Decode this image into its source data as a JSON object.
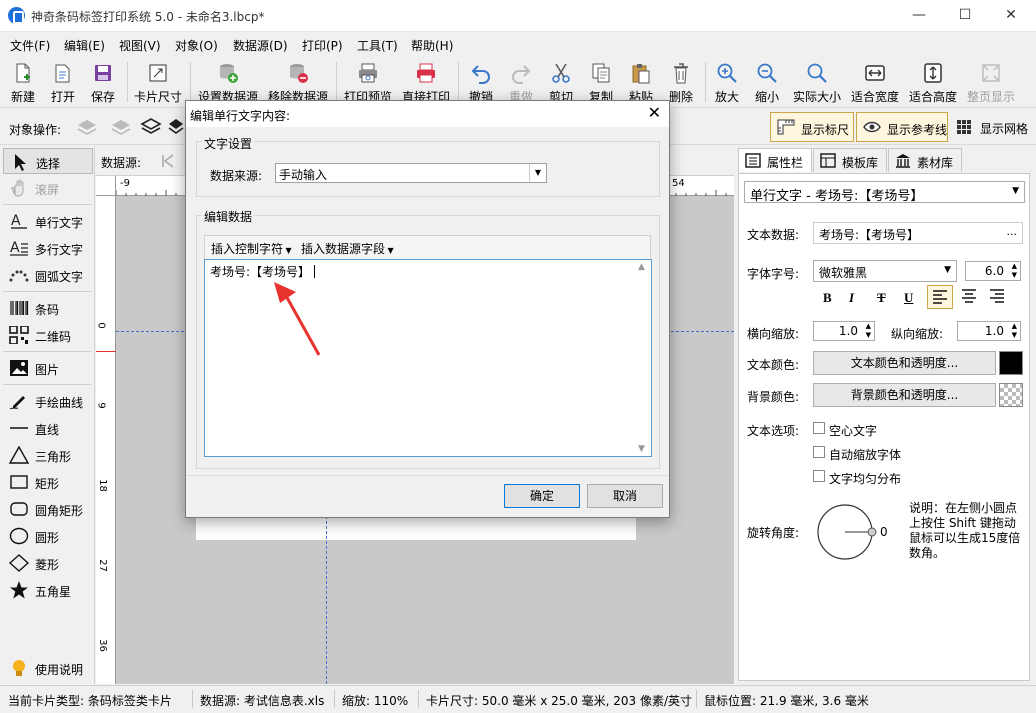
{
  "window": {
    "title": "神奇条码标签打印系统 5.0 - 未命名3.lbcp*"
  },
  "menu": [
    "文件(F)",
    "编辑(E)",
    "视图(V)",
    "对象(O)",
    "数据源(D)",
    "打印(P)",
    "工具(T)",
    "帮助(H)"
  ],
  "toolbar": {
    "new": "新建",
    "open": "打开",
    "save": "保存",
    "card_size": "卡片尺寸",
    "set_datasource": "设置数据源",
    "remove_datasource": "移除数据源",
    "print_preview": "打印预览",
    "direct_print": "直接打印",
    "undo": "撤销",
    "redo": "重做",
    "cut": "剪切",
    "copy": "复制",
    "paste": "粘贴",
    "delete": "删除",
    "zoom_in": "放大",
    "zoom_out": "缩小",
    "actual_size": "实际大小",
    "fit_width": "适合宽度",
    "fit_height": "适合高度",
    "fit_page": "整页显示"
  },
  "objbar": {
    "label": "对象操作:",
    "show_ruler": "显示标尺",
    "show_guides": "显示参考线",
    "show_grid": "显示网格"
  },
  "left_tools": {
    "select": "选择",
    "scroll": "滚屏",
    "single_text": "单行文字",
    "multi_text": "多行文字",
    "arc_text": "圆弧文字",
    "barcode": "条码",
    "qrcode": "二维码",
    "image": "图片",
    "freehand": "手绘曲线",
    "line": "直线",
    "triangle": "三角形",
    "rect": "矩形",
    "round_rect": "圆角矩形",
    "circle": "圆形",
    "diamond": "菱形",
    "star": "五角星",
    "help": "使用说明"
  },
  "canvas": {
    "datasource_label": "数据源:",
    "ruler_marks_h": [
      "-9",
      "54"
    ],
    "ruler_marks_v": [
      "0",
      "9",
      "18",
      "27",
      "36"
    ]
  },
  "right_panel": {
    "tabs": [
      "属性栏",
      "模板库",
      "素材库"
    ],
    "object_select": "单行文字 - 考场号:【考场号】",
    "text_data_label": "文本数据:",
    "text_data_value": "考场号:【考场号】",
    "text_data_more": "...",
    "font_label": "字体字号:",
    "font_value": "微软雅黑",
    "font_size": "6.0",
    "format_bold": "B",
    "format_italic": "I",
    "format_strike": "T",
    "format_underline": "U",
    "hscale_label": "横向缩放:",
    "hscale_value": "1.0",
    "vscale_label": "纵向缩放:",
    "vscale_value": "1.0",
    "text_color_label": "文本颜色:",
    "text_color_btn": "文本颜色和透明度...",
    "bg_color_label": "背景颜色:",
    "bg_color_btn": "背景颜色和透明度...",
    "options_label": "文本选项:",
    "opt_hollow": "空心文字",
    "opt_autoscale": "自动缩放字体",
    "opt_even": "文字均匀分布",
    "rotate_label": "旋转角度:",
    "rotate_value": "0",
    "rotate_tip": "说明：在左侧小圆点上按住 Shift 键拖动鼠标可以生成15度倍数角。",
    "text_color": "#000000"
  },
  "dialog": {
    "title": "编辑单行文字内容:",
    "close": "✕",
    "group_text_settings": "文字设置",
    "datasource_label": "数据来源:",
    "datasource_value": "手动输入",
    "group_edit_data": "编辑数据",
    "insert_control": "插入控制字符",
    "insert_field": "插入数据源字段",
    "content": "考场号:【考场号】",
    "ok": "确定",
    "cancel": "取消"
  },
  "status": {
    "card_type": "当前卡片类型: 条码标签类卡片",
    "datasource": "数据源: 考试信息表.xls",
    "zoom": "缩放: 110%",
    "card_size": "卡片尺寸: 50.0 毫米 x 25.0 毫米, 203 像素/英寸",
    "mouse_pos": "鼠标位置: 21.9 毫米, 3.6 毫米"
  },
  "colors": {
    "accent": "#1e6fd9",
    "print_red": "#d9304a",
    "arrow_red": "#e8322e"
  }
}
